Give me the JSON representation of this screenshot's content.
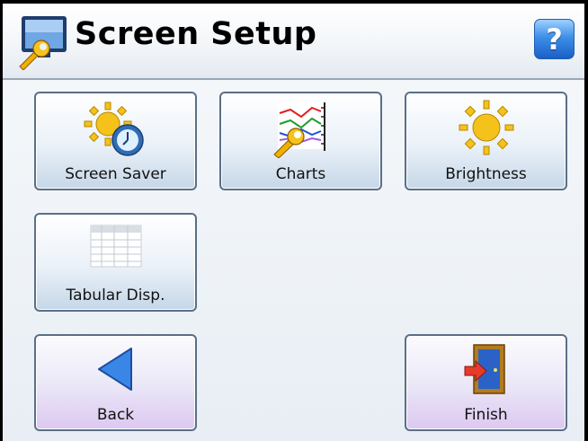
{
  "header": {
    "title": "Screen Setup",
    "setup_icon": "monitor-wrench-icon",
    "help_label": "?",
    "help_icon": "help-icon"
  },
  "buttons": {
    "screen_saver": {
      "label": "Screen Saver",
      "icon": "sun-clock-icon"
    },
    "charts": {
      "label": "Charts",
      "icon": "chart-wrench-icon"
    },
    "brightness": {
      "label": "Brightness",
      "icon": "sun-icon"
    },
    "tabular": {
      "label": "Tabular Disp.",
      "icon": "table-icon"
    },
    "back": {
      "label": "Back",
      "icon": "back-arrow-icon"
    },
    "finish": {
      "label": "Finish",
      "icon": "exit-door-icon"
    }
  },
  "colors": {
    "accent_blue": "#3e8fe8",
    "button_bottom": "#c6d7e8",
    "nav_button_bottom": "#dcc8f1",
    "border": "#5a6f86"
  }
}
